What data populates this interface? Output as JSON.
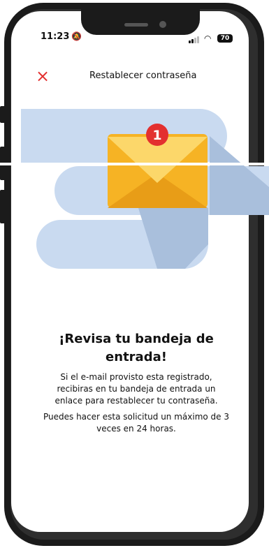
{
  "status_bar": {
    "time": "11:23",
    "bell_icon": "bell-slash-icon",
    "wifi_icon": "wifi-icon",
    "battery": "70"
  },
  "header": {
    "close_icon": "close-icon",
    "title": "Restablecer contraseña"
  },
  "illustration": {
    "badge_count": "1",
    "colors": {
      "stripe": "#c9daf0",
      "envelope": "#f6b324",
      "badge": "#e3302f"
    }
  },
  "message": {
    "heading": "¡Revisa tu bandeja de entrada!",
    "paragraph_1": "Si el e-mail provisto esta registrado, recibiras en tu bandeja de entrada un enlace para restablecer tu contraseña.",
    "paragraph_2": "Puedes hacer esta solicitud un máximo de 3 veces en 24 horas."
  }
}
